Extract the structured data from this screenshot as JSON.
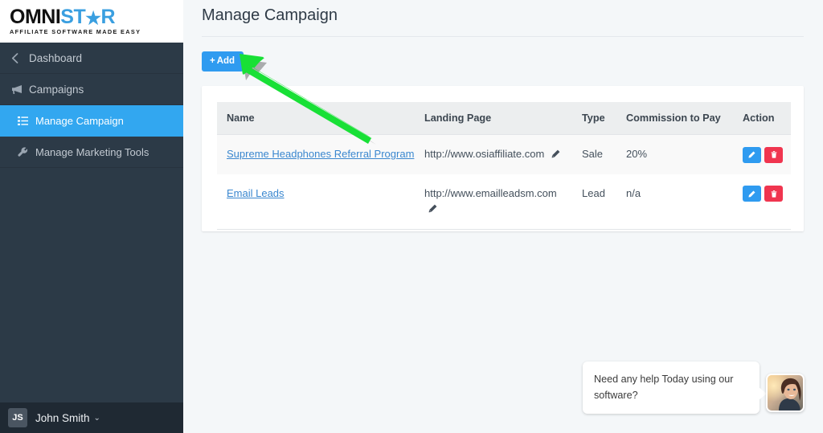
{
  "brand": {
    "logo_text_dark": "OMNI",
    "logo_text_light_a": "ST",
    "logo_star_glyph": "★",
    "logo_text_light_b": "R",
    "tagline": "AFFILIATE SOFTWARE MADE EASY",
    "accent_blue": "#32a7f0",
    "sidebar_bg": "#2c3a47",
    "page_bg": "#f4f7f9"
  },
  "sidebar": {
    "items": [
      {
        "label": "Dashboard",
        "icon": "chevron-left-icon",
        "level": 1,
        "active": false
      },
      {
        "label": "Campaigns",
        "icon": "megaphone-icon",
        "level": 1,
        "active": false
      },
      {
        "label": "Manage Campaign",
        "icon": "list-icon",
        "level": 2,
        "active": true
      },
      {
        "label": "Manage Marketing Tools",
        "icon": "wrench-icon",
        "level": 2,
        "active": false
      }
    ]
  },
  "user": {
    "initials": "JS",
    "name": "John Smith",
    "caret": "⌄"
  },
  "header": {
    "title": "Manage Campaign"
  },
  "toolbar": {
    "add_label": "Add",
    "add_plus": "+"
  },
  "table": {
    "columns": [
      "Name",
      "Landing Page",
      "Type",
      "Commission to Pay",
      "Action"
    ],
    "rows": [
      {
        "name": "Supreme Headphones Referral Program",
        "landing_page": "http://www.osiaffiliate.com",
        "type": "Sale",
        "commission": "20%"
      },
      {
        "name": "Email Leads",
        "landing_page": "http://www.emailleadsm.com",
        "type": "Lead",
        "commission": "n/a"
      }
    ],
    "action_edit_icon": "pencil-icon",
    "action_delete_icon": "trash-icon",
    "edit_button_color": "#2f9bf0",
    "delete_button_color": "#f0354f"
  },
  "chat": {
    "message": "Need any help Today using our software?",
    "avatar_alt": "support-agent-photo"
  },
  "annotation": {
    "arrow_color": "#18e036",
    "arrow_points_to": "add-button"
  }
}
